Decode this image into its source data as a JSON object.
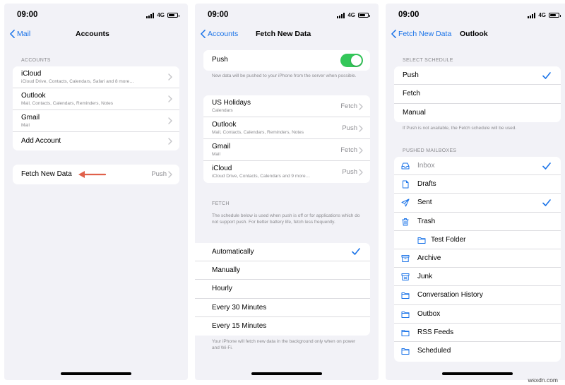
{
  "status": {
    "time": "09:00",
    "network": "4G"
  },
  "screen1": {
    "back": "Mail",
    "title": "Accounts",
    "section": "ACCOUNTS",
    "accounts": [
      {
        "name": "iCloud",
        "detail": "iCloud Drive, Contacts, Calendars, Safari and 8 more…"
      },
      {
        "name": "Outlook",
        "detail": "Mail, Contacts, Calendars, Reminders, Notes"
      },
      {
        "name": "Gmail",
        "detail": "Mail"
      }
    ],
    "add_account": "Add Account",
    "fetch_label": "Fetch New Data",
    "fetch_value": "Push",
    "arrow_color": "#e0604a"
  },
  "screen2": {
    "back": "Accounts",
    "title": "Fetch New Data",
    "push_label": "Push",
    "push_on": true,
    "push_note": "New data will be pushed to your iPhone from the server when possible.",
    "accounts": [
      {
        "name": "US Holidays",
        "detail": "Calendars",
        "value": "Fetch"
      },
      {
        "name": "Outlook",
        "detail": "Mail, Contacts, Calendars, Reminders, Notes",
        "value": "Push"
      },
      {
        "name": "Gmail",
        "detail": "Mail",
        "value": "Fetch"
      },
      {
        "name": "iCloud",
        "detail": "iCloud Drive, Contacts, Calendars and 9 more…",
        "value": "Push"
      }
    ],
    "fetch_section": "FETCH",
    "fetch_note": "The schedule below is used when push is off or for applications which do not support push. For better battery life, fetch less frequently.",
    "intervals": [
      "Automatically",
      "Manually",
      "Hourly",
      "Every 30 Minutes",
      "Every 15 Minutes"
    ],
    "selected_interval": "Automatically",
    "bottom_note": "Your iPhone will fetch new data in the background only when on power and Wi-Fi."
  },
  "screen3": {
    "back": "Fetch New Data",
    "title": "Outlook",
    "schedule_section": "SELECT SCHEDULE",
    "schedules": [
      "Push",
      "Fetch",
      "Manual"
    ],
    "selected_schedule": "Push",
    "schedule_note": "If Push is not available, the Fetch schedule will be used.",
    "mailbox_section": "PUSHED MAILBOXES",
    "mailboxes": [
      {
        "name": "Inbox",
        "icon": "inbox-icon",
        "checked": true,
        "dim": true
      },
      {
        "name": "Drafts",
        "icon": "document-icon",
        "checked": false
      },
      {
        "name": "Sent",
        "icon": "paperplane-icon",
        "checked": true
      },
      {
        "name": "Trash",
        "icon": "trash-icon",
        "checked": false
      },
      {
        "name": "Test Folder",
        "icon": "folder-icon",
        "checked": false,
        "sub": true
      },
      {
        "name": "Archive",
        "icon": "archive-icon",
        "checked": false
      },
      {
        "name": "Junk",
        "icon": "junk-icon",
        "checked": false
      },
      {
        "name": "Conversation History",
        "icon": "folder-icon",
        "checked": false
      },
      {
        "name": "Outbox",
        "icon": "folder-icon",
        "checked": false
      },
      {
        "name": "RSS Feeds",
        "icon": "folder-icon",
        "checked": false
      },
      {
        "name": "Scheduled",
        "icon": "folder-icon",
        "checked": false
      }
    ]
  },
  "watermark": "wsxdn.com",
  "colors": {
    "accent": "#1a73e8",
    "toggle": "#34c759"
  }
}
